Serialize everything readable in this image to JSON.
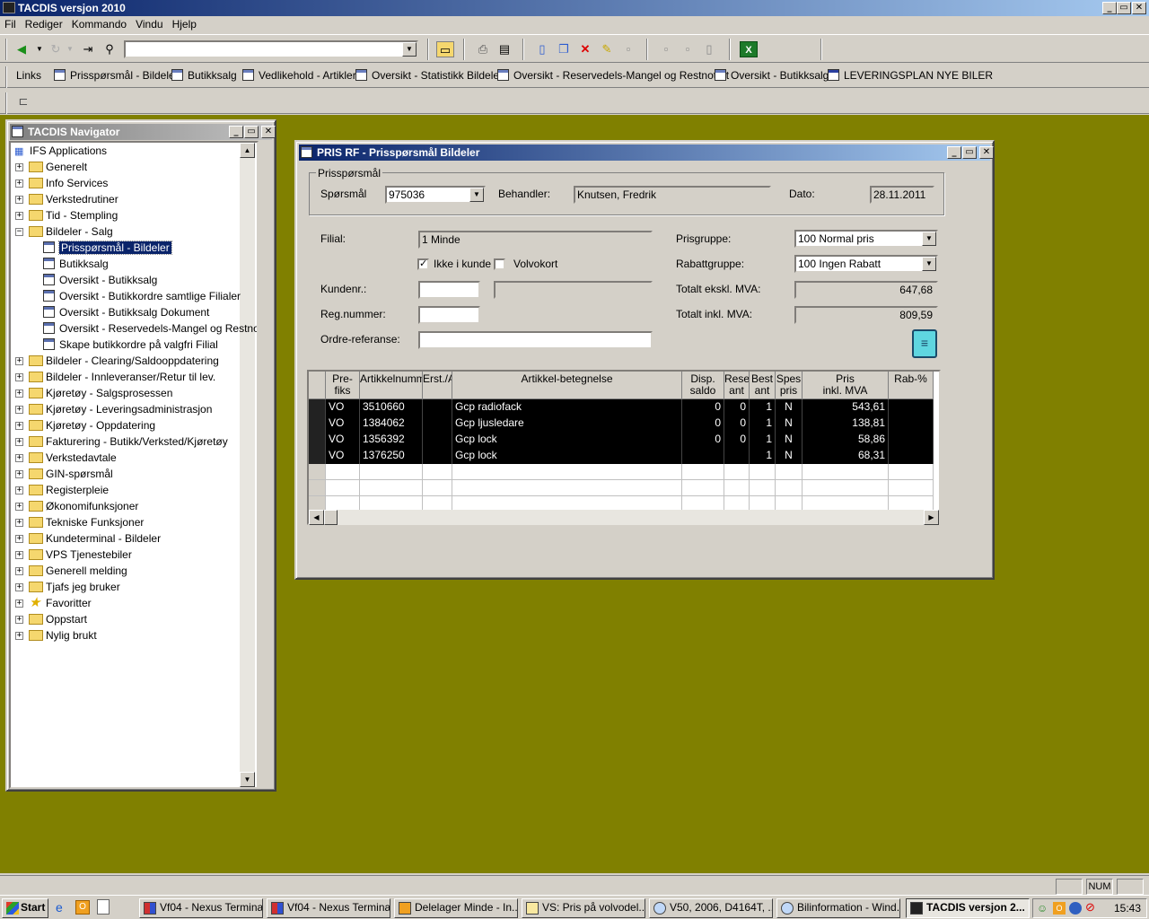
{
  "app": {
    "title": "TACDIS versjon 2010",
    "win_min": "_",
    "win_restore": "▭",
    "win_close": "✕"
  },
  "menu": [
    "Fil",
    "Rediger",
    "Kommando",
    "Vindu",
    "Hjelp"
  ],
  "links": {
    "label": "Links",
    "items": [
      "Prisspørsmål - Bildeler",
      "Butikksalg",
      "Vedlikehold - Artikler",
      "Oversikt - Statistikk Bildeler",
      "Oversikt - Reservedels-Mangel og Restnotert",
      "Oversikt - Butikksalg",
      "LEVERINGSPLAN NYE BILER"
    ]
  },
  "navigator": {
    "title": "TACDIS Navigator",
    "root": "IFS Applications",
    "items": [
      {
        "label": "Generelt",
        "type": "folder",
        "expanded": false
      },
      {
        "label": "Info Services",
        "type": "folder",
        "expanded": false
      },
      {
        "label": "Verkstedrutiner",
        "type": "folder",
        "expanded": false
      },
      {
        "label": "Tid - Stempling",
        "type": "folder",
        "expanded": false
      },
      {
        "label": "Bildeler - Salg",
        "type": "folder",
        "expanded": true
      },
      {
        "label": "Prisspørsmål - Bildeler",
        "type": "doc",
        "child": true,
        "selected": true
      },
      {
        "label": "Butikksalg",
        "type": "doc",
        "child": true
      },
      {
        "label": "Oversikt - Butikksalg",
        "type": "doc",
        "child": true
      },
      {
        "label": "Oversikt - Butikkordre samtlige Filialer",
        "type": "doc",
        "child": true
      },
      {
        "label": "Oversikt - Butikksalg Dokument",
        "type": "doc",
        "child": true
      },
      {
        "label": "Oversikt - Reservedels-Mangel og Restnotert",
        "type": "doc",
        "child": true
      },
      {
        "label": "Skape butikkordre på valgfri Filial",
        "type": "doc",
        "child": true
      },
      {
        "label": "Bildeler - Clearing/Saldooppdatering",
        "type": "folder"
      },
      {
        "label": "Bildeler - Innleveranser/Retur til lev.",
        "type": "folder"
      },
      {
        "label": "Kjøretøy - Salgsprosessen",
        "type": "folder"
      },
      {
        "label": "Kjøretøy - Leveringsadministrasjon",
        "type": "folder"
      },
      {
        "label": "Kjøretøy - Oppdatering",
        "type": "folder"
      },
      {
        "label": "Fakturering - Butikk/Verksted/Kjøretøy",
        "type": "folder"
      },
      {
        "label": "Verkstedavtale",
        "type": "folder"
      },
      {
        "label": "GIN-spørsmål",
        "type": "folder"
      },
      {
        "label": "Registerpleie",
        "type": "folder"
      },
      {
        "label": "Økonomifunksjoner",
        "type": "folder"
      },
      {
        "label": "Tekniske Funksjoner",
        "type": "folder"
      },
      {
        "label": "Kundeterminal - Bildeler",
        "type": "folder"
      },
      {
        "label": "VPS Tjenestebiler",
        "type": "folder"
      },
      {
        "label": "Generell melding",
        "type": "folder"
      },
      {
        "label": "Tjafs jeg bruker",
        "type": "folder"
      },
      {
        "label": "Favoritter",
        "type": "star"
      },
      {
        "label": "Oppstart",
        "type": "folder"
      },
      {
        "label": "Nylig brukt",
        "type": "folder"
      }
    ]
  },
  "form": {
    "title": "PRIS RF - Prisspørsmål Bildeler",
    "group": "Prisspørsmål",
    "sporsmal_label": "Spørsmål",
    "sporsmal": "975036",
    "behandler_label": "Behandler:",
    "behandler": "Knutsen, Fredrik",
    "dato_label": "Dato:",
    "dato": "28.11.2011",
    "filial_label": "Filial:",
    "filial": "1 Minde",
    "ikke_i_kunde": "Ikke i kunde",
    "volvokort": "Volvokort",
    "kundenr_label": "Kundenr.:",
    "regnr_label": "Reg.nummer:",
    "ordre_label": "Ordre-referanse:",
    "prisgruppe_label": "Prisgruppe:",
    "prisgruppe": "100 Normal pris",
    "rabattgruppe_label": "Rabattgruppe:",
    "rabattgruppe": "100 Ingen Rabatt",
    "eks_label": "Totalt ekskl. MVA:",
    "eks": "647,68",
    "inkl_label": "Totalt inkl. MVA:",
    "inkl": "809,59"
  },
  "grid": {
    "headers": [
      "Pre-\nfiks",
      "Artikkelnummer",
      "Erst./Al",
      "Artikkel-betegnelse",
      "Disp.\nsaldo",
      "Rese\nant",
      "Best\nant",
      "Spes\npris",
      "Pris\ninkl. MVA",
      "Rab-%"
    ],
    "rows": [
      [
        "VO",
        "3510660",
        "",
        "Gcp radiofack",
        "0",
        "0",
        "1",
        "N",
        "543,61",
        ""
      ],
      [
        "VO",
        "1384062",
        "",
        "Gcp ljusledare",
        "0",
        "0",
        "1",
        "N",
        "138,81",
        ""
      ],
      [
        "VO",
        "1356392",
        "",
        "Gcp lock",
        "0",
        "0",
        "1",
        "N",
        "58,86",
        ""
      ],
      [
        "VO",
        "1376250",
        "",
        "Gcp lock",
        "",
        "",
        "1",
        "N",
        "68,31",
        ""
      ]
    ]
  },
  "status": {
    "num": "NUM"
  },
  "taskbar": {
    "start": "Start",
    "items": [
      "Vf04 - Nexus Terminal",
      "Vf04 - Nexus Terminal",
      "Delelager Minde - In...",
      "VS: Pris på volvodel...",
      "V50, 2006, D4164T, ...",
      "Bilinformation - Wind...",
      "TACDIS versjon 2..."
    ],
    "time": "15:43"
  }
}
